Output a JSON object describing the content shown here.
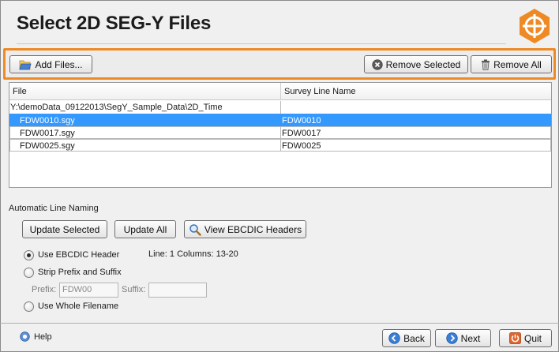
{
  "header": {
    "title": "Select 2D SEG-Y Files",
    "logo_icon": "crosshair-hexagon-icon",
    "accent_color": "#ee8a25"
  },
  "toolbar": {
    "add_files_label": "Add Files...",
    "remove_selected_label": "Remove Selected",
    "remove_all_label": "Remove All"
  },
  "table": {
    "columns": [
      "File",
      "Survey Line Name"
    ],
    "group_path": "Y:\\demoData_09122013\\SegY_Sample_Data\\2D_Time",
    "rows": [
      {
        "file": "FDW0010.sgy",
        "survey_line": "FDW0010",
        "selected": true
      },
      {
        "file": "FDW0017.sgy",
        "survey_line": "FDW0017",
        "selected": false
      },
      {
        "file": "FDW0025.sgy",
        "survey_line": "FDW0025",
        "selected": false
      }
    ],
    "selection_color": "#3399ff"
  },
  "naming": {
    "section_label": "Automatic Line Naming",
    "update_selected_label": "Update Selected",
    "update_all_label": "Update All",
    "view_ebcdic_label": "View EBCDIC Headers",
    "options": {
      "use_ebcdic": "Use EBCDIC Header",
      "strip_prefix_suffix": "Strip Prefix and Suffix",
      "use_whole_filename": "Use Whole Filename"
    },
    "selected_option": "use_ebcdic",
    "line_info": "Line: 1 Columns: 13-20",
    "prefix_label": "Prefix:",
    "prefix_value": "FDW00",
    "suffix_label": "Suffix:",
    "suffix_value": ""
  },
  "footer": {
    "help_label": "Help",
    "back_label": "Back",
    "next_label": "Next",
    "quit_label": "Quit"
  }
}
